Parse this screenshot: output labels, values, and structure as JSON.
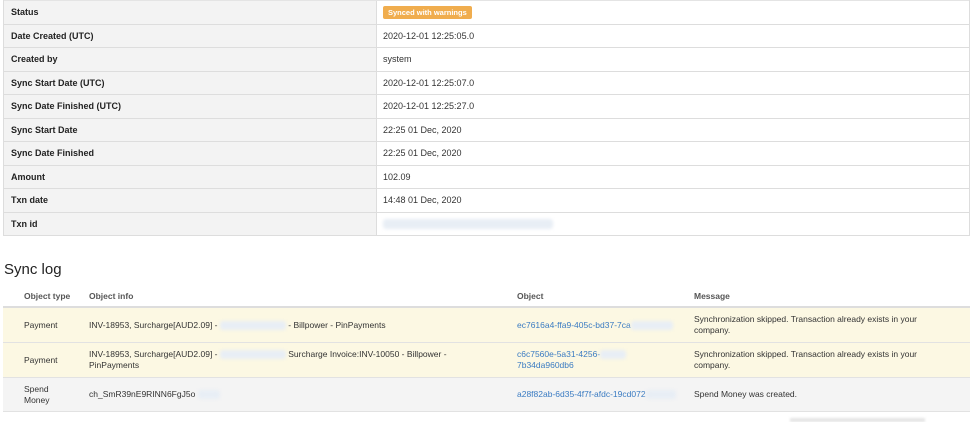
{
  "details": [
    {
      "label": "Status",
      "value": "",
      "badge": "Synced with warnings"
    },
    {
      "label": "Date Created (UTC)",
      "value": "2020-12-01 12:25:05.0"
    },
    {
      "label": "Created by",
      "value": "system"
    },
    {
      "label": "Sync Start Date (UTC)",
      "value": "2020-12-01 12:25:07.0"
    },
    {
      "label": "Sync Date Finished (UTC)",
      "value": "2020-12-01 12:25:27.0"
    },
    {
      "label": "Sync Start Date",
      "value": "22:25 01 Dec, 2020"
    },
    {
      "label": "Sync Date Finished",
      "value": "22:25 01 Dec, 2020"
    },
    {
      "label": "Amount",
      "value": "102.09"
    },
    {
      "label": "Txn date",
      "value": "14:48 01 Dec, 2020"
    },
    {
      "label": "Txn id",
      "value": ""
    }
  ],
  "colors": {
    "badge": "#f0ad4e",
    "warning_row": "#fcf8e3",
    "link": "#3a7bc2"
  },
  "sync_log": {
    "title": "Sync log",
    "columns": [
      "Object type",
      "Object info",
      "Object",
      "Message"
    ],
    "rows": [
      {
        "type": "Payment",
        "info_a": "INV-18953, Surcharge[AUD2.09] -",
        "info_b": "- Billpower - PinPayments",
        "object": "ec7616a4-ffa9-405c-bd37-7ca",
        "message": "Synchronization skipped. Transaction already exists in your company."
      },
      {
        "type": "Payment",
        "info_a": "INV-18953, Surcharge[AUD2.09] -",
        "info_b": "Surcharge Invoice:INV-10050 - Billpower - PinPayments",
        "object": "c6c7560e-5a31-4256-",
        "object_b": "7b34da960db6",
        "message": "Synchronization skipped. Transaction already exists in your company."
      },
      {
        "type": "Spend Money",
        "info_a": "ch_SmR39nE9RINN6FgJ5o",
        "object": "a28f82ab-6d35-4f7f-afdc-19cd072",
        "message": "Spend Money was created."
      }
    ]
  }
}
